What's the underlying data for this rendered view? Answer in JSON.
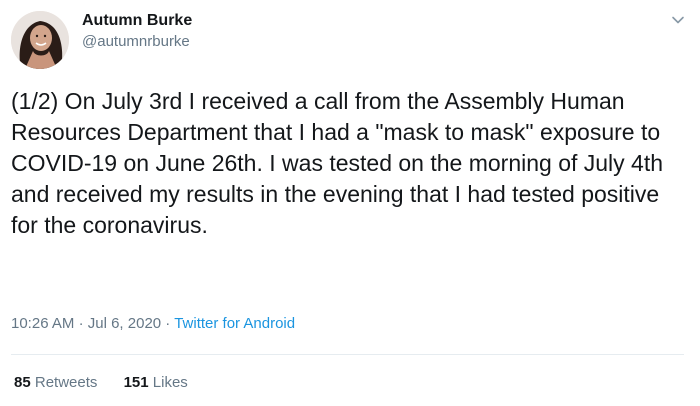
{
  "author": {
    "display_name": "Autumn Burke",
    "handle": "@autumnrburke"
  },
  "tweet": {
    "text": "(1/2) On July 3rd I received a call from the Assembly Human Resources Department that I had a \"mask to mask\" exposure to COVID-19 on June 26th. I was tested on the morning of July 4th and received my results in the evening that I had tested positive for the coronavirus.",
    "time": "10:26 AM",
    "date": "Jul 6, 2020",
    "separator": "·",
    "source": "Twitter for Android"
  },
  "stats": {
    "retweets_count": "85",
    "retweets_label": "Retweets",
    "likes_count": "151",
    "likes_label": "Likes"
  },
  "icons": {
    "menu": "chevron-down-icon"
  },
  "colors": {
    "link": "#1b95e0",
    "secondary_text": "#657786",
    "primary_text": "#14171a",
    "divider": "#e6ecf0"
  }
}
